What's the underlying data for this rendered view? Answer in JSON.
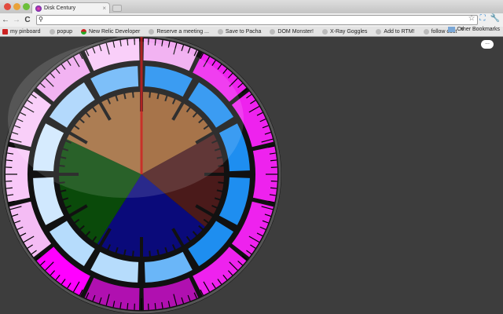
{
  "window": {
    "tab_title": "Disk Century",
    "tab_close": "×"
  },
  "toolbar": {
    "back": "←",
    "forward": "→",
    "reload": "C",
    "search_icon": "search-icon",
    "address": "",
    "star": "☆"
  },
  "bookmarks": {
    "items": [
      "my pinboard",
      "popup",
      "New Relic Developer",
      "Reserve a meeting ...",
      "Save to Pacha",
      "DOM Monster!",
      "X-Ray Goggles",
      "Add to RTM!",
      "follow cost"
    ],
    "overflow": "»",
    "other": "Other Bookmarks"
  },
  "overlay": {
    "menu_bubble": "..."
  },
  "disk": {
    "pie": [
      {
        "fraction": 0.17,
        "color": "#9a6030"
      },
      {
        "fraction": 0.19,
        "color": "#4a1a1a"
      },
      {
        "fraction": 0.23,
        "color": "#0a0a7a"
      },
      {
        "fraction": 0.23,
        "color": "#0a4a0a"
      },
      {
        "fraction": 0.18,
        "color": "#a06a3a"
      }
    ],
    "middle_ring_colors": [
      "#1e8ef0",
      "#1e8ef0",
      "#1e8ef0",
      "#1e8ef0",
      "#1e8ef0",
      "#6ab6f8",
      "#b6dcfc",
      "#b6dcfc",
      "#d0e8fe",
      "#d0e8fe",
      "#a8d4fc",
      "#6ab6f8"
    ],
    "outer_ring_colors": [
      "#f0a8f0",
      "#ee22ee",
      "#ee22ee",
      "#ee22ee",
      "#ee22ee",
      "#ee22ee",
      "#b010b0",
      "#b010b0",
      "#ff00ff",
      "#f4bcf4",
      "#f8c8f8",
      "#f8c8f8",
      "#f0a8f0",
      "#f8c8f8"
    ],
    "accent": "#d02020"
  }
}
